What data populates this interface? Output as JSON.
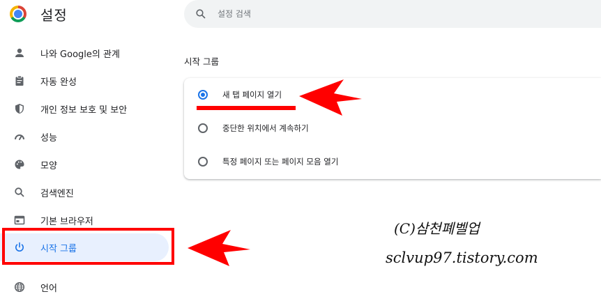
{
  "app": {
    "title": "설정"
  },
  "search": {
    "placeholder": "설정 검색"
  },
  "sidebar": {
    "items": [
      {
        "label": "나와 Google의 관계",
        "icon": "person-icon"
      },
      {
        "label": "자동 완성",
        "icon": "clipboard-icon"
      },
      {
        "label": "개인 정보 보호 및 보안",
        "icon": "shield-icon"
      },
      {
        "label": "성능",
        "icon": "speedometer-icon"
      },
      {
        "label": "모양",
        "icon": "palette-icon"
      },
      {
        "label": "검색엔진",
        "icon": "search-icon"
      },
      {
        "label": "기본 브라우저",
        "icon": "browser-window-icon"
      },
      {
        "label": "시작 그룹",
        "icon": "power-icon",
        "active": true
      },
      {
        "label": "언어",
        "icon": "globe-icon"
      }
    ]
  },
  "main": {
    "section_title": "시작 그룹",
    "options": [
      {
        "label": "새 탭 페이지 열기",
        "selected": true
      },
      {
        "label": "중단한 위치에서 계속하기",
        "selected": false
      },
      {
        "label": "특정 페이지 또는 페이지 모음 열기",
        "selected": false
      }
    ]
  },
  "annotations": {
    "watermark_line1": "(C)삼천폐벨업",
    "watermark_line2": "sclvup97.tistory.com",
    "highlight_color": "#ff0000"
  },
  "colors": {
    "accent": "#1a73e8",
    "active_bg": "#e8f0fe",
    "search_bg": "#f1f3f4",
    "text": "#202124",
    "icon": "#5f6368"
  }
}
